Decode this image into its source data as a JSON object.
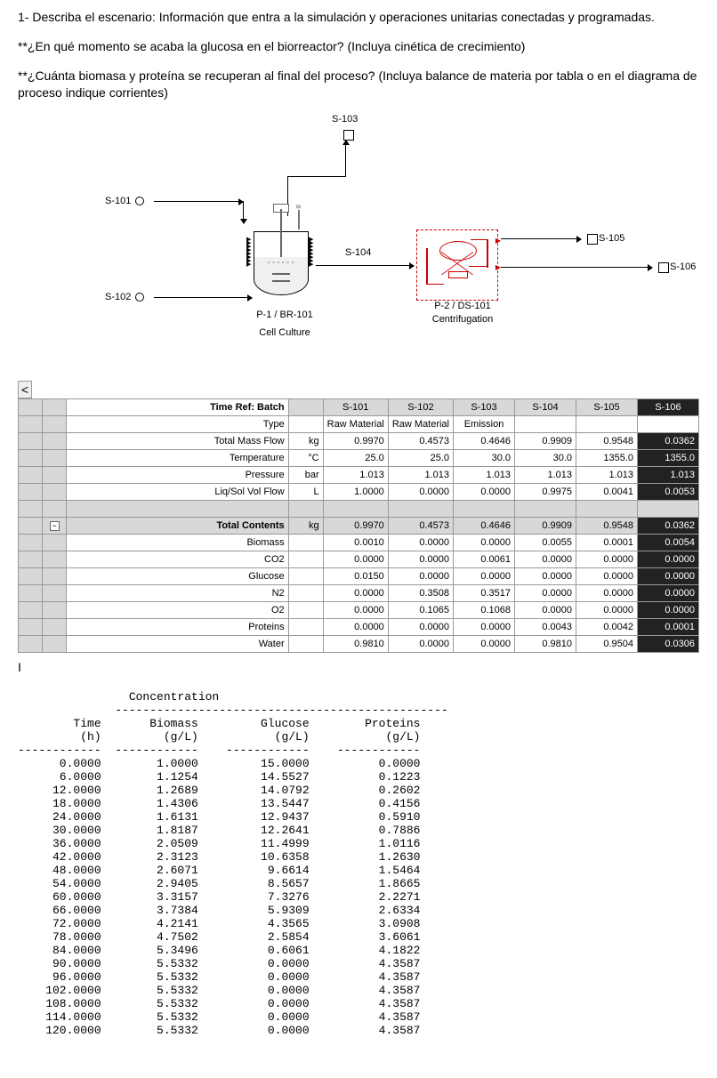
{
  "questions": {
    "q1": "1- Describa el escenario: Información que entra a la simulación y operaciones unitarias conectadas y programadas.",
    "q2": "**¿En qué momento se acaba la glucosa en el biorreactor? (Incluya cinética de crecimiento)",
    "q3": "**¿Cuánta biomasa y proteína se recuperan al final del proceso? (Incluya balance de materia por tabla o en el diagrama de proceso indique corrientes)"
  },
  "diagram": {
    "s101": "S-101",
    "s102": "S-102",
    "s103": "S-103",
    "s104": "S-104",
    "s105": "S-105",
    "s106": "S-106",
    "reactor_name": "P-1 / BR-101",
    "reactor_sub": "Cell Culture",
    "centrifuge_name": "P-2 / DS-101",
    "centrifuge_sub": "Centrifugation",
    "scroll_left": "<"
  },
  "streams": {
    "head_time": "Time Ref: Batch",
    "head_cols": [
      "S-101",
      "S-102",
      "S-103",
      "S-104",
      "S-105",
      "S-106"
    ],
    "type_label": "Type",
    "types": [
      "Raw Material",
      "Raw Material",
      "Emission",
      "",
      "",
      ""
    ],
    "tmf_label": "Total Mass Flow",
    "tmf_unit": "kg",
    "tmf": [
      "0.9970",
      "0.4573",
      "0.4646",
      "0.9909",
      "0.9548",
      "0.0362"
    ],
    "temp_label": "Temperature",
    "temp_unit": "°C",
    "temp": [
      "25.0",
      "25.0",
      "30.0",
      "30.0",
      "1355.0",
      "1355.0"
    ],
    "press_label": "Pressure",
    "press_unit": "bar",
    "press": [
      "1.013",
      "1.013",
      "1.013",
      "1.013",
      "1.013",
      "1.013"
    ],
    "lsvf_label": "Liq/Sol Vol Flow",
    "lsvf_unit": "L",
    "lsvf": [
      "1.0000",
      "0.0000",
      "0.0000",
      "0.9975",
      "0.0041",
      "0.0053"
    ],
    "tc_label": "Total Contents",
    "tc_unit": "kg",
    "tc": [
      "0.9970",
      "0.4573",
      "0.4646",
      "0.9909",
      "0.9548",
      "0.0362"
    ],
    "comp_labels": [
      "Biomass",
      "CO2",
      "Glucose",
      "N2",
      "O2",
      "Proteins",
      "Water"
    ],
    "comp_vals": [
      [
        "0.0010",
        "0.0000",
        "0.0000",
        "0.0055",
        "0.0001",
        "0.0054"
      ],
      [
        "0.0000",
        "0.0000",
        "0.0061",
        "0.0000",
        "0.0000",
        "0.0000"
      ],
      [
        "0.0150",
        "0.0000",
        "0.0000",
        "0.0000",
        "0.0000",
        "0.0000"
      ],
      [
        "0.0000",
        "0.3508",
        "0.3517",
        "0.0000",
        "0.0000",
        "0.0000"
      ],
      [
        "0.0000",
        "0.1065",
        "0.1068",
        "0.0000",
        "0.0000",
        "0.0000"
      ],
      [
        "0.0000",
        "0.0000",
        "0.0000",
        "0.0043",
        "0.0042",
        "0.0001"
      ],
      [
        "0.9810",
        "0.0000",
        "0.0000",
        "0.9810",
        "0.9504",
        "0.0306"
      ]
    ]
  },
  "cursor": "I",
  "conc": {
    "title": "Concentration",
    "col_time": "Time",
    "col_time_u": "(h)",
    "col_bio": "Biomass",
    "col_bio_u": "(g/L)",
    "col_glu": "Glucose",
    "col_glu_u": "(g/L)",
    "col_pro": "Proteins",
    "col_pro_u": "(g/L)",
    "rows": [
      [
        "0.0000",
        "1.0000",
        "15.0000",
        "0.0000"
      ],
      [
        "6.0000",
        "1.1254",
        "14.5527",
        "0.1223"
      ],
      [
        "12.0000",
        "1.2689",
        "14.0792",
        "0.2602"
      ],
      [
        "18.0000",
        "1.4306",
        "13.5447",
        "0.4156"
      ],
      [
        "24.0000",
        "1.6131",
        "12.9437",
        "0.5910"
      ],
      [
        "30.0000",
        "1.8187",
        "12.2641",
        "0.7886"
      ],
      [
        "36.0000",
        "2.0509",
        "11.4999",
        "1.0116"
      ],
      [
        "42.0000",
        "2.3123",
        "10.6358",
        "1.2630"
      ],
      [
        "48.0000",
        "2.6071",
        "9.6614",
        "1.5464"
      ],
      [
        "54.0000",
        "2.9405",
        "8.5657",
        "1.8665"
      ],
      [
        "60.0000",
        "3.3157",
        "7.3276",
        "2.2271"
      ],
      [
        "66.0000",
        "3.7384",
        "5.9309",
        "2.6334"
      ],
      [
        "72.0000",
        "4.2141",
        "4.3565",
        "3.0908"
      ],
      [
        "78.0000",
        "4.7502",
        "2.5854",
        "3.6061"
      ],
      [
        "84.0000",
        "5.3496",
        "0.6061",
        "4.1822"
      ],
      [
        "90.0000",
        "5.5332",
        "0.0000",
        "4.3587"
      ],
      [
        "96.0000",
        "5.5332",
        "0.0000",
        "4.3587"
      ],
      [
        "102.0000",
        "5.5332",
        "0.0000",
        "4.3587"
      ],
      [
        "108.0000",
        "5.5332",
        "0.0000",
        "4.3587"
      ],
      [
        "114.0000",
        "5.5332",
        "0.0000",
        "4.3587"
      ],
      [
        "120.0000",
        "5.5332",
        "0.0000",
        "4.3587"
      ]
    ]
  }
}
